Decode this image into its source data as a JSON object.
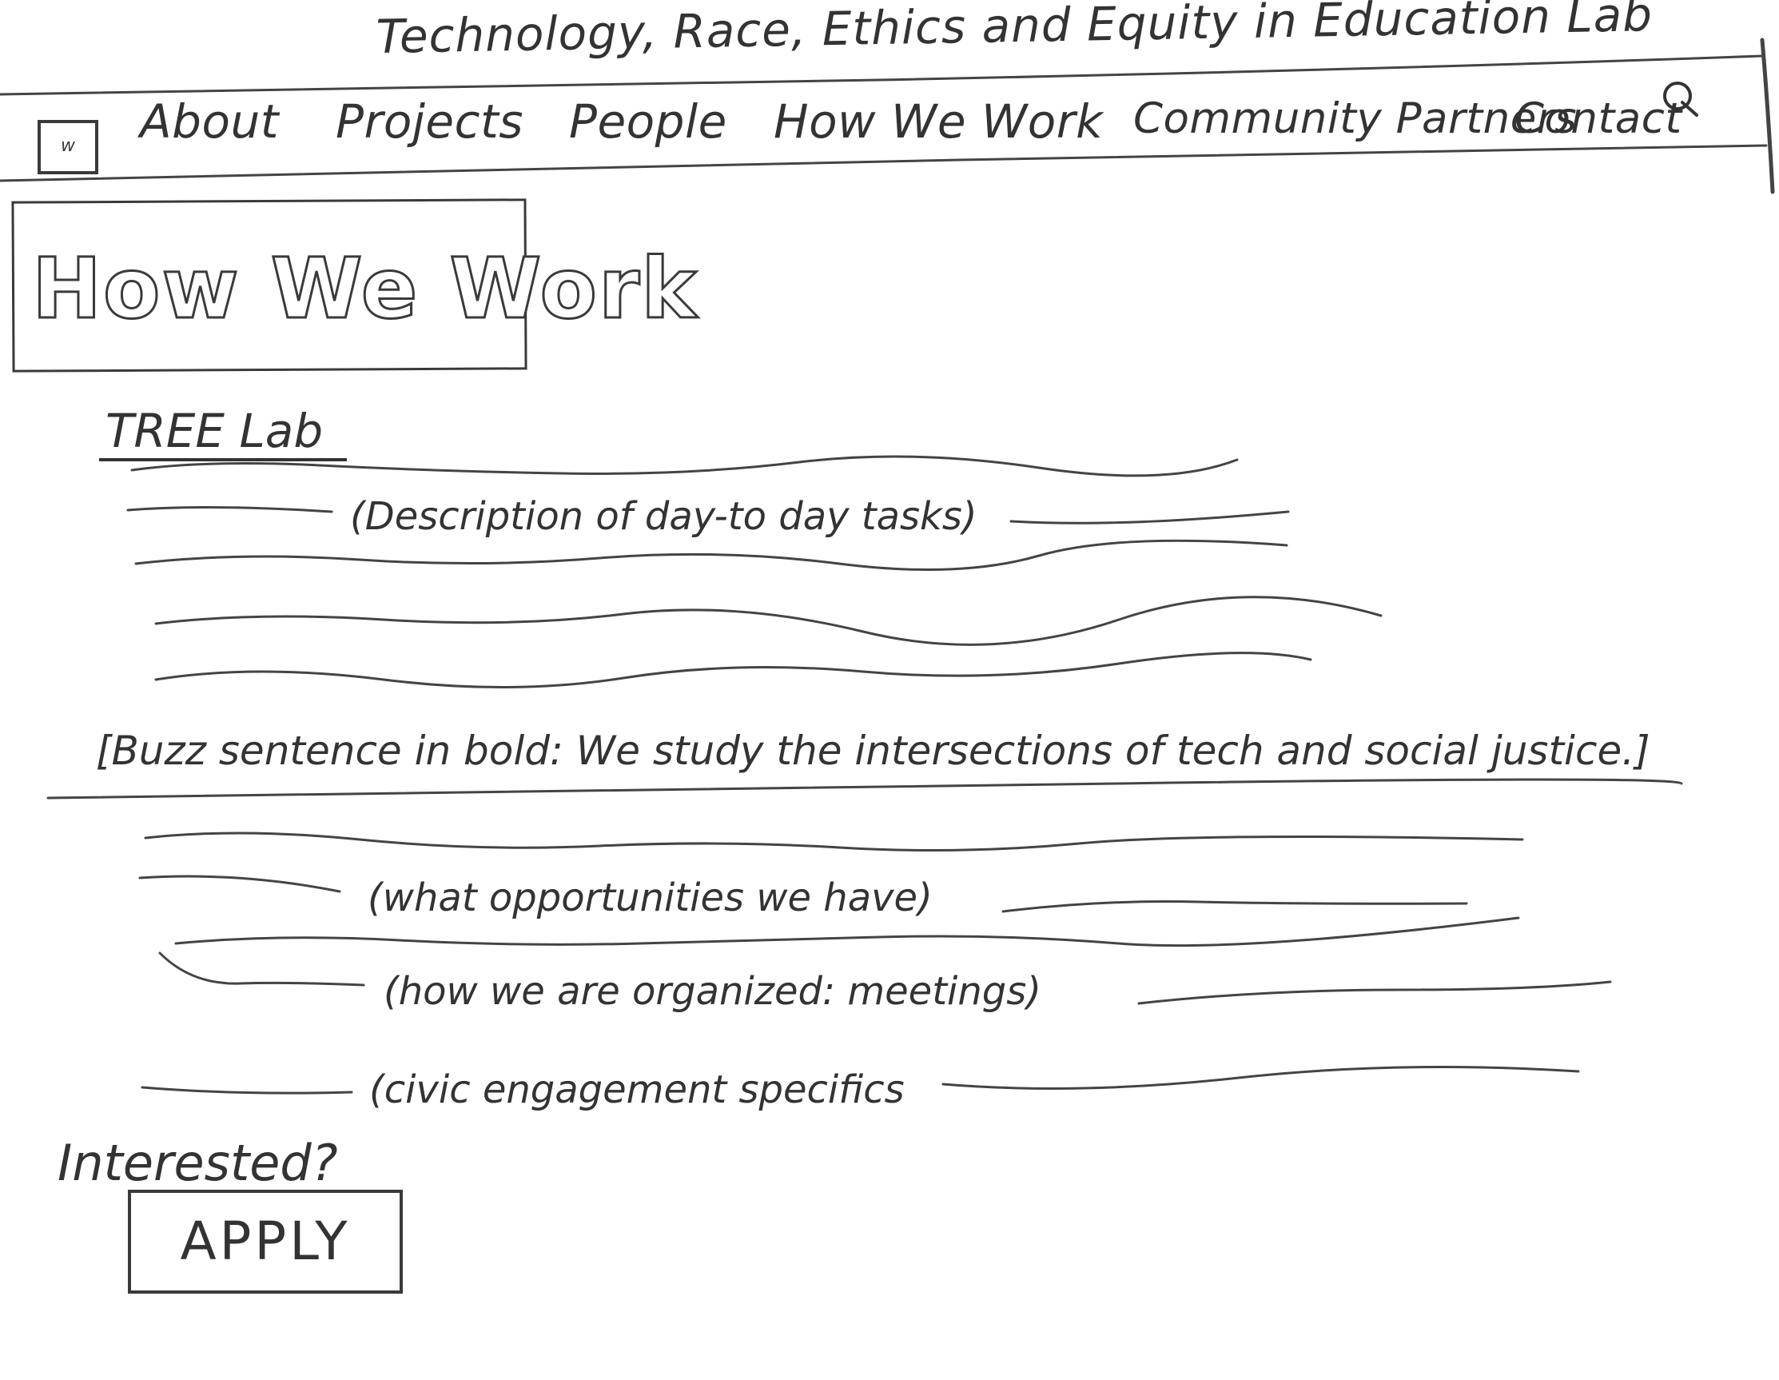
{
  "header": {
    "site_title": "Technology, Race, Ethics and Equity in Education Lab"
  },
  "nav": {
    "logo_text": "w",
    "items": [
      {
        "label": "About"
      },
      {
        "label": "Projects"
      },
      {
        "label": "People"
      },
      {
        "label": "How We Work"
      },
      {
        "label": "Community Partners"
      },
      {
        "label": "Contact"
      }
    ],
    "search_icon": "search-icon"
  },
  "hero": {
    "title": "How We Work"
  },
  "section": {
    "heading": "TREE Lab",
    "description_placeholder": "(Description of day-to day tasks)"
  },
  "buzz": {
    "text": "[Buzz sentence in bold: We study the intersections of tech and social justice.]"
  },
  "details": {
    "opportunities": "(what opportunities we have)",
    "organization": "(how we are organized: meetings)",
    "civic": "(civic engagement specifics"
  },
  "cta": {
    "prompt": "Interested?",
    "button_label": "APPLY"
  },
  "colors": {
    "ink": "#3a3a3a",
    "paper": "#ffffff"
  }
}
